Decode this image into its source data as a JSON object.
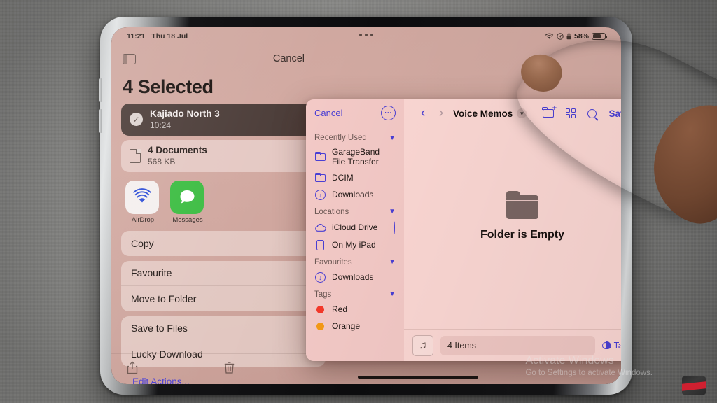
{
  "status_bar": {
    "time": "11:21",
    "date": "Thu 18 Jul",
    "wifi_icon": "wifi-icon",
    "location_icon": "location-icon",
    "lock_icon": "lock-icon",
    "battery_percent": "58%",
    "battery_icon": "battery-icon"
  },
  "background_app": {
    "sidebar_toggle_icon": "sidebar-toggle-icon",
    "cancel_label": "Cancel",
    "title": "4 Selected",
    "selected_item": {
      "name": "Kajiado North 3",
      "time": "10:24",
      "check_icon": "checkmark-icon"
    },
    "attachment": {
      "title": "4 Documents",
      "size": "568 KB",
      "doc_icon": "document-icon"
    },
    "share_apps": [
      {
        "label": "AirDrop",
        "icon": "airdrop-icon"
      },
      {
        "label": "Messages",
        "icon": "messages-icon"
      }
    ],
    "actions_group_1": [
      "Copy"
    ],
    "actions_group_2": [
      "Favourite",
      "Move to Folder"
    ],
    "actions_group_3": [
      "Save to Files",
      "Lucky Download"
    ],
    "edit_actions_label": "Edit Actions...",
    "bottom_bar": {
      "share_icon": "share-icon",
      "trash_icon": "trash-icon"
    }
  },
  "files_dialog": {
    "sidebar": {
      "cancel_label": "Cancel",
      "more_icon": "more-ellipsis-icon",
      "sections": [
        {
          "title": "Recently Used",
          "chevron_icon": "chevron-down-icon",
          "items": [
            {
              "label": "GarageBand\nFile Transfer",
              "icon": "folder-icon"
            },
            {
              "label": "DCIM",
              "icon": "folder-icon"
            },
            {
              "label": "Downloads",
              "icon": "download-circle-icon"
            }
          ]
        },
        {
          "title": "Locations",
          "chevron_icon": "chevron-down-icon",
          "items": [
            {
              "label": "iCloud Drive",
              "icon": "cloud-icon",
              "trailing_icon": "sync-spinner-icon"
            },
            {
              "label": "On My iPad",
              "icon": "ipad-icon"
            }
          ]
        },
        {
          "title": "Favourites",
          "chevron_icon": "chevron-down-icon",
          "items": [
            {
              "label": "Downloads",
              "icon": "download-circle-icon"
            }
          ]
        },
        {
          "title": "Tags",
          "chevron_icon": "chevron-down-icon",
          "items": [
            {
              "label": "Red",
              "icon": "tag-dot-icon",
              "color": "#f5392a"
            },
            {
              "label": "Orange",
              "icon": "tag-dot-icon",
              "color": "#f59a16"
            }
          ]
        }
      ]
    },
    "toolbar": {
      "back_icon": "chevron-left-icon",
      "forward_icon": "chevron-right-icon",
      "path_title": "Voice Memos",
      "path_chevron_icon": "chevron-down-icon",
      "new_folder_icon": "new-folder-icon",
      "grid_view_icon": "grid-view-icon",
      "search_icon": "search-icon",
      "save_label": "Save"
    },
    "empty_state": {
      "folder_icon": "folder-large-icon",
      "message": "Folder is Empty"
    },
    "bottom_bar": {
      "file_thumb_icon": "music-note-icon",
      "filename_value": "4 Items",
      "tags_label": "Tags",
      "tags_icon": "tags-icon"
    }
  },
  "watermark": {
    "title": "Activate Windows",
    "subtitle": "Go to Settings to activate Windows."
  },
  "colors": {
    "accent_blue": "#4a3fd4",
    "dialog_sidebar": "#f3c9c6",
    "dialog_content": "#fbd7d3",
    "tag_red": "#f5392a",
    "tag_orange": "#f59a16"
  }
}
